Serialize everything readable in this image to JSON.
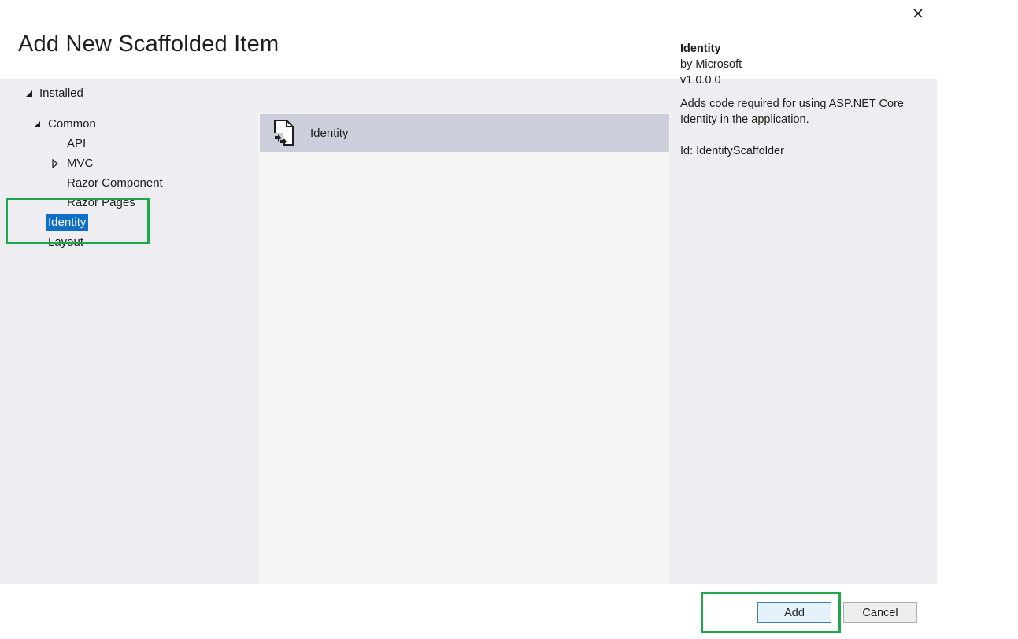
{
  "dialog": {
    "title": "Add New Scaffolded Item",
    "close_icon": "close-icon"
  },
  "tree": {
    "installed_label": "Installed",
    "common_label": "Common",
    "api_label": "API",
    "mvc_label": "MVC",
    "razor_component_label": "Razor Component",
    "razor_pages_label": "Razor Pages",
    "identity_label": "Identity",
    "layout_label": "Layout",
    "selected": "Identity"
  },
  "items": [
    {
      "name": "Identity",
      "icon": "scaffold-file-icon"
    }
  ],
  "details": {
    "title": "Identity",
    "author": "by Microsoft",
    "version": "v1.0.0.0",
    "description": "Adds code required for using ASP.NET Core Identity in the application.",
    "id_text": "Id: IdentityScaffolder"
  },
  "buttons": {
    "add_label": "Add",
    "cancel_label": "Cancel"
  },
  "colors": {
    "selection": "#0e6fc4",
    "highlight_box": "#1fa84a",
    "panel_bg": "#eeeef2",
    "item_selected_bg": "#cccedb"
  }
}
